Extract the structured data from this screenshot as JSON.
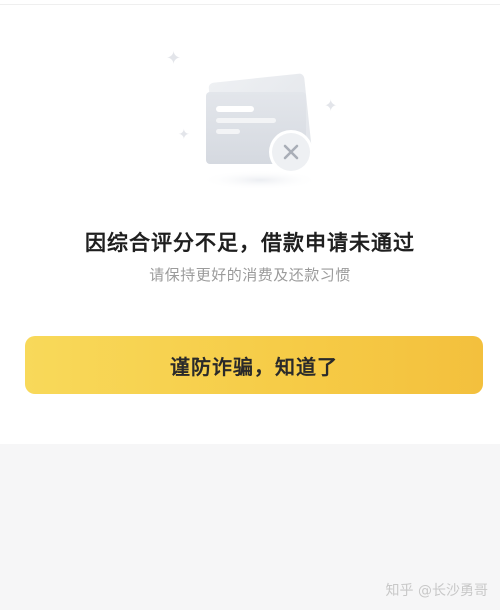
{
  "dialog": {
    "title": "因综合评分不足，借款申请未通过",
    "subtitle": "请保持更好的消费及还款习惯",
    "button_label": "谨防诈骗，知道了"
  },
  "illustration": {
    "icon": "rejected-card-icon",
    "badge_icon": "close-x-icon"
  },
  "watermark": {
    "text": "知乎 @长沙勇哥"
  },
  "colors": {
    "button_start": "#f8d95a",
    "button_end": "#f3c03d",
    "title_text": "#1f1f1f",
    "subtitle_text": "#9b9b9b",
    "page_background": "#f6f6f7"
  }
}
